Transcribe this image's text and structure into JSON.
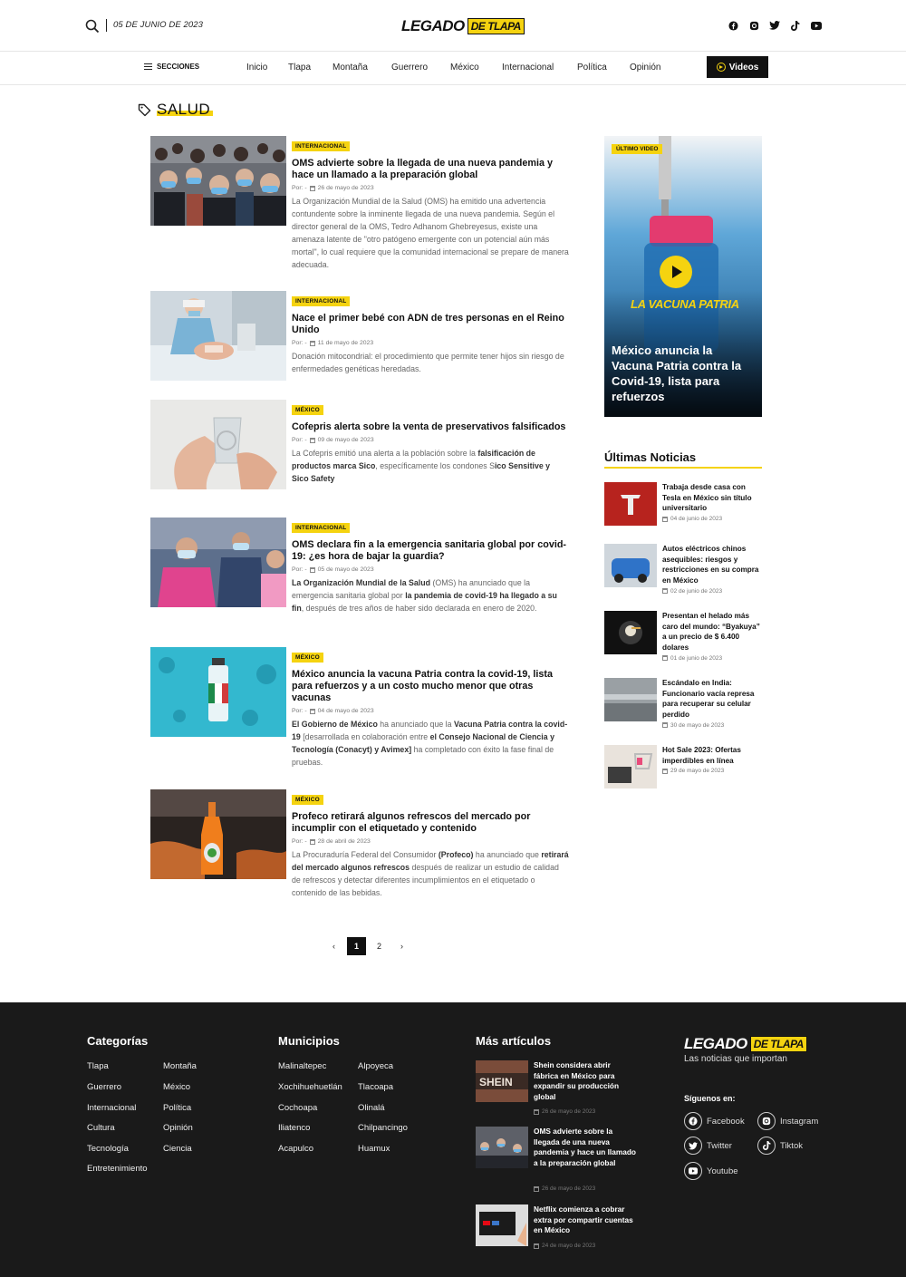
{
  "header": {
    "date": "05 DE JUNIO DE 2023",
    "logo_main": "LEGADO",
    "logo_accent": "DE TLAPA",
    "social": [
      "facebook-icon",
      "instagram-icon",
      "twitter-icon",
      "tiktok-icon",
      "youtube-icon"
    ]
  },
  "nav": {
    "sections_label": "SECCIONES",
    "items": [
      "Inicio",
      "Tlapa",
      "Montaña",
      "Guerrero",
      "México",
      "Internacional",
      "Política",
      "Opinión"
    ],
    "videos_label": "Videos"
  },
  "section": {
    "title": "SALUD"
  },
  "articles": [
    {
      "category": "INTERNACIONAL",
      "title": "OMS advierte sobre la llegada de una nueva pandemia y hace un llamado a la preparación global",
      "author": "Por: -",
      "date": "26 de mayo de 2023",
      "excerpt": "La Organización Mundial de la Salud (OMS) ha emitido una advertencia contundente sobre la inminente llegada de una nueva pandemia. Según el director general de la OMS, Tedro Adhanom Ghebreyesus, existe una amenaza latente de \"otro patógeno emergente con un potencial aún más mortal\", lo cual requiere que la comunidad internacional se prepare de manera adecuada."
    },
    {
      "category": "INTERNACIONAL",
      "title": "Nace el primer bebé con ADN de tres personas en el Reino Unido",
      "author": "Por: -",
      "date": "11 de mayo de 2023",
      "excerpt": "Donación mitocondrial: el procedimiento que permite tener hijos sin riesgo de enfermedades genéticas heredadas."
    },
    {
      "category": "MÉXICO",
      "title": "Cofepris alerta sobre la venta de preservativos falsificados",
      "author": "Por: -",
      "date": "09 de mayo de 2023",
      "excerpt_a": "La Cofepris emitió una alerta a la población sobre la ",
      "excerpt_b": "falsificación de productos marca Sico",
      "excerpt_c": ", específicamente los condones S",
      "excerpt_d": "ico Sensitive y Sico Safety"
    },
    {
      "category": "INTERNACIONAL",
      "title": "OMS declara fin a la emergencia sanitaria global por covid-19: ¿es hora de bajar la guardia?",
      "author": "Por: -",
      "date": "05 de mayo de 2023",
      "excerpt_a": "La Organización Mundial de la Salud",
      "excerpt_b": " (OMS) ha anunciado que la emergencia sanitaria global por ",
      "excerpt_c": "la pandemia de covid-19 ha llegado a su fin",
      "excerpt_d": ", después de tres años de haber sido declarada en enero de 2020."
    },
    {
      "category": "MÉXICO",
      "title": "México anuncia la vacuna Patria contra la covid-19, lista para refuerzos y a un costo mucho menor que otras vacunas",
      "author": "Por: -",
      "date": "04 de mayo de 2023",
      "excerpt_a": "El Gobierno de México",
      "excerpt_b": " ha anunciado que la ",
      "excerpt_c": "Vacuna Patria contra la covid-19",
      "excerpt_d": " [desarrollada en colaboración entre ",
      "excerpt_e": "el Consejo Nacional de Ciencia y Tecnología (Conacyt) y Avimex]",
      "excerpt_f": " ha completado con éxito la fase final de pruebas."
    },
    {
      "category": "MÉXICO",
      "title": "Profeco retirará algunos refrescos del mercado por incumplir con el etiquetado y contenido",
      "author": "Por: -",
      "date": "28 de abril de 2023",
      "excerpt_a": "La Procuraduría Federal del Consumidor ",
      "excerpt_b": "(Profeco)",
      "excerpt_c": " ha anunciado que ",
      "excerpt_d": "retirará del mercado algunos refrescos",
      "excerpt_e": " después de realizar un estudio de calidad de refrescos y detectar diferentes incumplimientos en el etiquetado o contenido de las bebidas."
    }
  ],
  "pagination": {
    "pages": [
      "1",
      "2"
    ],
    "current": "1"
  },
  "sidebar": {
    "video_badge": "ÚLTIMO VIDEO",
    "video_stamp": "LA VACUNA PATRIA",
    "video_title": "México anuncia la Vacuna Patria contra la Covid-19, lista para refuerzos",
    "latest_title": "Últimas Noticias",
    "latest": [
      {
        "title": "Trabaja desde casa con Tesla en México sin título universitario",
        "date": "04 de junio de 2023"
      },
      {
        "title": "Autos eléctricos chinos asequibles: riesgos y restricciones en su compra en México",
        "date": "02 de junio de 2023"
      },
      {
        "title": "Presentan el helado más caro del mundo: “Byakuya” a un precio de $ 6.400 dolares",
        "date": "01 de junio de 2023"
      },
      {
        "title": "Escándalo en India: Funcionario vacía represa para recuperar su celular perdido",
        "date": "30 de mayo de 2023"
      },
      {
        "title": "Hot Sale 2023: Ofertas imperdibles en línea",
        "date": "29 de mayo de 2023"
      }
    ]
  },
  "footer": {
    "categories_title": "Categorías",
    "categories": [
      "Tlapa",
      "Montaña",
      "Guerrero",
      "México",
      "Internacional",
      "Política",
      "Cultura",
      "Opinión",
      "Tecnología",
      "Ciencia",
      "Entretenimiento"
    ],
    "municipios_title": "Municipios",
    "municipios": [
      "Malinaltepec",
      "Alpoyeca",
      "Xochihuehuetlán",
      "Tlacoapa",
      "Cochoapa",
      "Olinalá",
      "Iliatenco",
      "Chilpancingo",
      "Acapulco",
      "Huamux"
    ],
    "more_title": "Más artículos",
    "more": [
      {
        "title": "Shein considera abrir fábrica en México para expandir su producción global",
        "date": "26 de mayo de 2023"
      },
      {
        "title": "OMS advierte sobre la llegada de una nueva pandemia y hace un llamado a la preparación global",
        "date": "26 de mayo de 2023"
      },
      {
        "title": "Netflix comienza a cobrar extra por compartir cuentas en México",
        "date": "24 de mayo de 2023"
      }
    ],
    "logo_main": "LEGADO",
    "logo_accent": "DE TLAPA",
    "tagline": "Las noticias que importan",
    "follow_label": "Síguenos en:",
    "social": [
      "Facebook",
      "Instagram",
      "Twitter",
      "Tiktok",
      "Youtube"
    ]
  },
  "colors": {
    "accent": "#f5d310",
    "dark": "#1a1a1a"
  }
}
